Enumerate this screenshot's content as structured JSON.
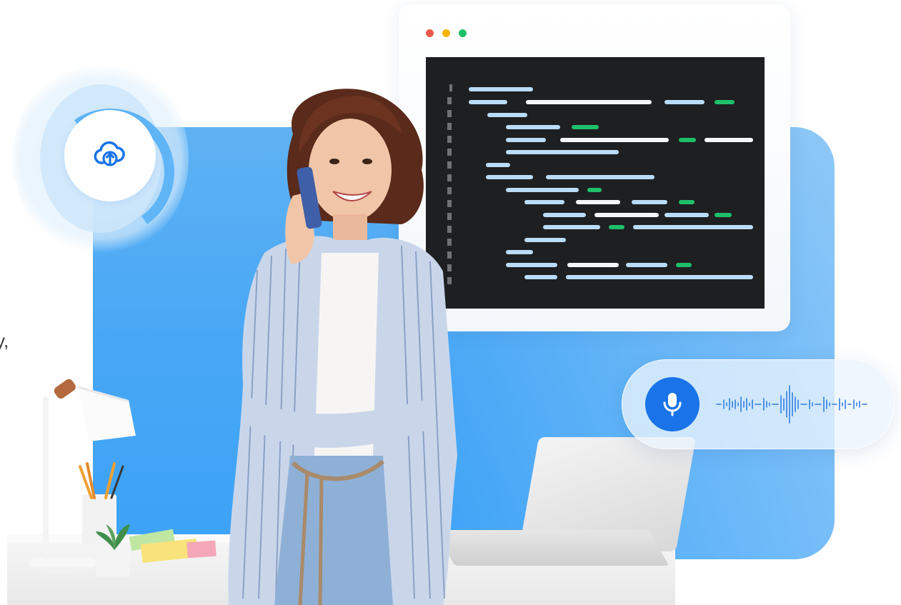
{
  "hero": {
    "partial_text": "y,"
  },
  "colors": {
    "accent_blue": "#1a73e8",
    "panel_blue": "#4aa8f5",
    "code_bg": "#1e1f21",
    "code_green": "#1fbf6a",
    "window_dot_red": "#f15a4a",
    "window_dot_yellow": "#f7b500",
    "window_dot_green": "#1fbf6a"
  },
  "icons": {
    "upload": "cloud-upload-icon",
    "mic": "microphone-icon",
    "waveform": "audio-waveform-icon"
  }
}
